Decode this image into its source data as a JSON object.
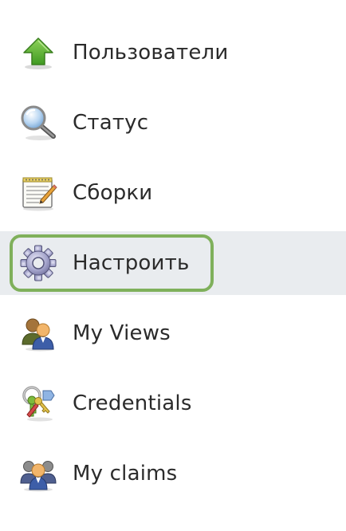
{
  "sidebar": {
    "items": [
      {
        "label": "Пользователи",
        "icon": "users-arrow-up-icon"
      },
      {
        "label": "Статус",
        "icon": "magnifier-icon"
      },
      {
        "label": "Сборки",
        "icon": "notepad-pencil-icon"
      },
      {
        "label": "Настроить",
        "icon": "gear-icon",
        "active": true
      },
      {
        "label": "My Views",
        "icon": "people-icon"
      },
      {
        "label": "Credentials",
        "icon": "keys-icon"
      },
      {
        "label": "My claims",
        "icon": "people-group-icon"
      }
    ]
  }
}
